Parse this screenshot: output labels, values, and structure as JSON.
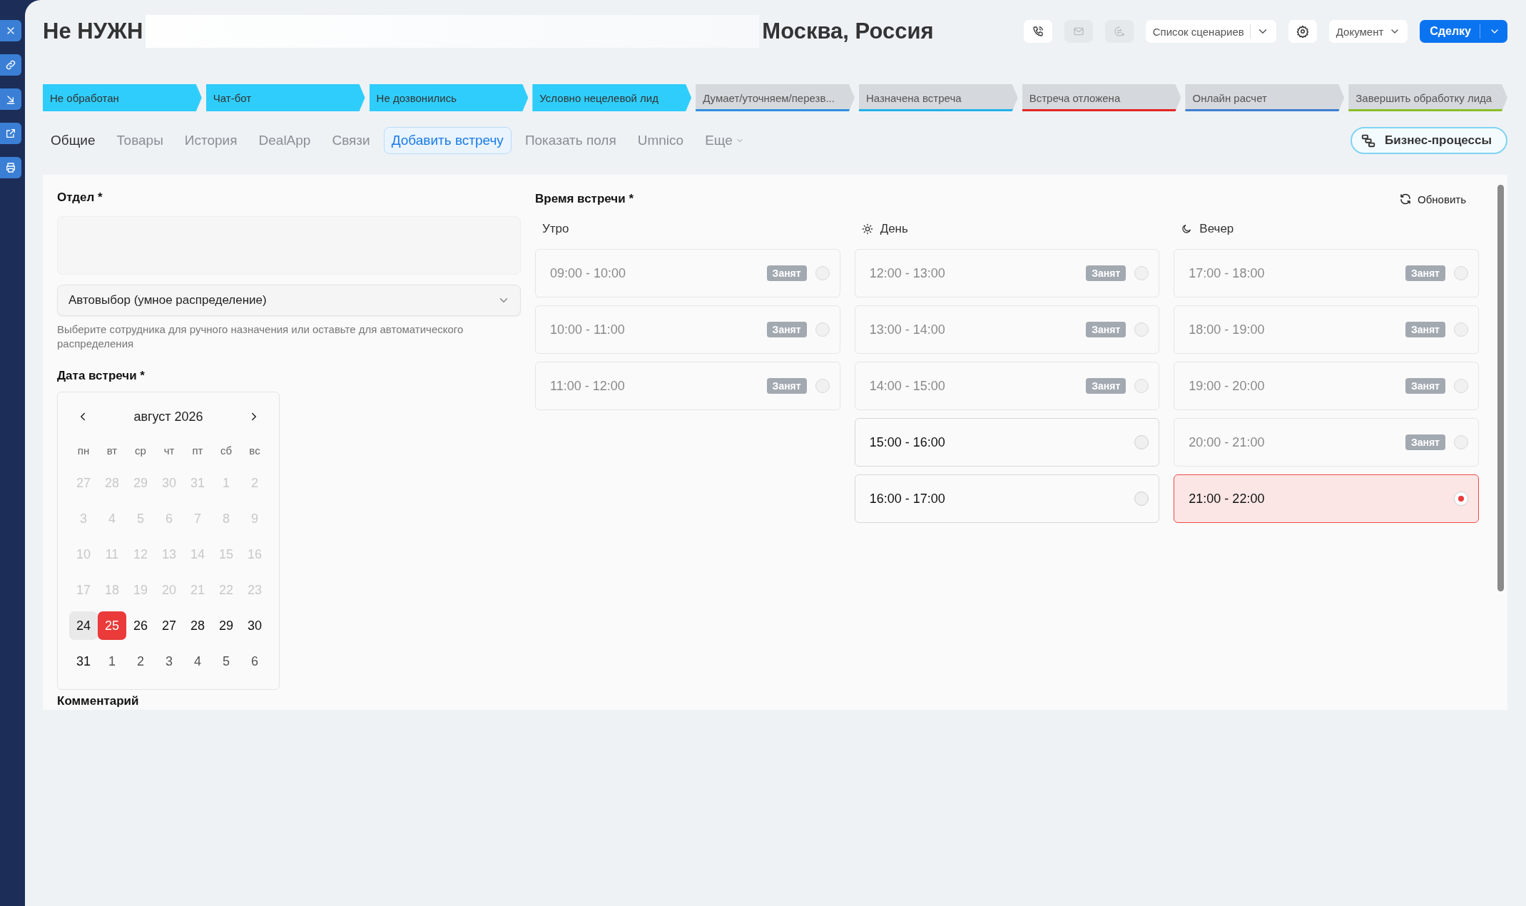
{
  "sidebar": {
    "buttons": [
      {
        "kind": "close"
      },
      {
        "kind": "link"
      },
      {
        "kind": "import"
      },
      {
        "kind": "external"
      },
      {
        "kind": "print"
      }
    ]
  },
  "header": {
    "title_start": "Не НУЖН",
    "title_end": "Москва, Россия",
    "icon_buttons": [
      {
        "kind": "phone",
        "disabled": false
      },
      {
        "kind": "mail",
        "disabled": true
      },
      {
        "kind": "chat",
        "disabled": true
      }
    ],
    "scenario_dropdown": "Список сценариев",
    "document_dropdown": "Документ",
    "primary_button": "Сделку"
  },
  "stages": [
    {
      "label": "Не обработан",
      "completed": true,
      "color": "#2fcdfb"
    },
    {
      "label": "Чат-бот",
      "completed": true,
      "color": "#2fcdfb"
    },
    {
      "label": "Не дозвонились",
      "completed": true,
      "color": "#2fcdfb"
    },
    {
      "label": "Условно нецелевой лид",
      "completed": true,
      "color": "#2fcdfb"
    },
    {
      "label": "Думает/уточняем/перезв...",
      "completed": false,
      "color": "#2f8fe0"
    },
    {
      "label": "Назначена встреча",
      "completed": false,
      "color": "#1fb2ea"
    },
    {
      "label": "Встреча отложена",
      "completed": false,
      "color": "#e52424"
    },
    {
      "label": "Онлайн расчет",
      "completed": false,
      "color": "#3c7fd0"
    },
    {
      "label": "Завершить обработку лида",
      "completed": false,
      "color": "#8bbd2a"
    }
  ],
  "tabs": [
    {
      "label": "Общие",
      "selected": false,
      "kind": "main"
    },
    {
      "label": "Товары",
      "selected": false,
      "kind": "plain"
    },
    {
      "label": "История",
      "selected": false,
      "kind": "plain"
    },
    {
      "label": "DealApp",
      "selected": false,
      "kind": "plain"
    },
    {
      "label": "Связи",
      "selected": false,
      "kind": "plain"
    },
    {
      "label": "Добавить встречу",
      "selected": true,
      "kind": "plain"
    },
    {
      "label": "Показать поля",
      "selected": false,
      "kind": "plain"
    },
    {
      "label": "Umnico",
      "selected": false,
      "kind": "plain"
    },
    {
      "label": "Еще",
      "selected": false,
      "kind": "more"
    }
  ],
  "business_processes_button": "Бизнес-процессы",
  "form": {
    "department_label": "Отдел *",
    "employee_select": "Автовыбор (умное распределение)",
    "employee_hint": "Выберите сотрудника для ручного назначения или оставьте для автоматического распределения",
    "date_label": "Дата встречи *",
    "comment_label": "Комментарий",
    "calendar": {
      "month": "август 2026",
      "weekdays": [
        "пн",
        "вт",
        "ср",
        "чт",
        "пт",
        "сб",
        "вс"
      ],
      "days": [
        {
          "d": "27",
          "kind": "past",
          "selected": false
        },
        {
          "d": "28",
          "kind": "past",
          "selected": false
        },
        {
          "d": "29",
          "kind": "past",
          "selected": false
        },
        {
          "d": "30",
          "kind": "past",
          "selected": false
        },
        {
          "d": "31",
          "kind": "past",
          "selected": false
        },
        {
          "d": "1",
          "kind": "past",
          "selected": false
        },
        {
          "d": "2",
          "kind": "past",
          "selected": false
        },
        {
          "d": "3",
          "kind": "past",
          "selected": false
        },
        {
          "d": "4",
          "kind": "past",
          "selected": false
        },
        {
          "d": "5",
          "kind": "past",
          "selected": false
        },
        {
          "d": "6",
          "kind": "past",
          "selected": false
        },
        {
          "d": "7",
          "kind": "past",
          "selected": false
        },
        {
          "d": "8",
          "kind": "past",
          "selected": false
        },
        {
          "d": "9",
          "kind": "past",
          "selected": false
        },
        {
          "d": "10",
          "kind": "past",
          "selected": false
        },
        {
          "d": "11",
          "kind": "past",
          "selected": false
        },
        {
          "d": "12",
          "kind": "past",
          "selected": false
        },
        {
          "d": "13",
          "kind": "past",
          "selected": false
        },
        {
          "d": "14",
          "kind": "past",
          "selected": false
        },
        {
          "d": "15",
          "kind": "past",
          "selected": false
        },
        {
          "d": "16",
          "kind": "past",
          "selected": false
        },
        {
          "d": "17",
          "kind": "past",
          "selected": false
        },
        {
          "d": "18",
          "kind": "past",
          "selected": false
        },
        {
          "d": "19",
          "kind": "past",
          "selected": false
        },
        {
          "d": "20",
          "kind": "past",
          "selected": false
        },
        {
          "d": "21",
          "kind": "past",
          "selected": false
        },
        {
          "d": "22",
          "kind": "past",
          "selected": false
        },
        {
          "d": "23",
          "kind": "past",
          "selected": false
        },
        {
          "d": "24",
          "kind": "today",
          "selected": false
        },
        {
          "d": "25",
          "kind": "current",
          "selected": true
        },
        {
          "d": "26",
          "kind": "current",
          "selected": false
        },
        {
          "d": "27",
          "kind": "current",
          "selected": false
        },
        {
          "d": "28",
          "kind": "current",
          "selected": false
        },
        {
          "d": "29",
          "kind": "current",
          "selected": false
        },
        {
          "d": "30",
          "kind": "current",
          "selected": false
        },
        {
          "d": "31",
          "kind": "current",
          "selected": false
        },
        {
          "d": "1",
          "kind": "next",
          "selected": false
        },
        {
          "d": "2",
          "kind": "next",
          "selected": false
        },
        {
          "d": "3",
          "kind": "next",
          "selected": false
        },
        {
          "d": "4",
          "kind": "next",
          "selected": false
        },
        {
          "d": "5",
          "kind": "next",
          "selected": false
        },
        {
          "d": "6",
          "kind": "next",
          "selected": false
        }
      ]
    }
  },
  "time": {
    "label": "Время встречи *",
    "refresh_button": "Обновить",
    "periods": [
      {
        "name": "Утро",
        "slots": [
          {
            "time": "09:00 - 10:00",
            "busy": true,
            "badge": "Занят",
            "selected": false
          },
          {
            "time": "10:00 - 11:00",
            "busy": true,
            "badge": "Занят",
            "selected": false
          },
          {
            "time": "11:00 - 12:00",
            "busy": true,
            "badge": "Занят",
            "selected": false
          }
        ]
      },
      {
        "name": "День",
        "kind": "day",
        "slots": [
          {
            "time": "12:00 - 13:00",
            "busy": true,
            "badge": "Занят",
            "selected": false
          },
          {
            "time": "13:00 - 14:00",
            "busy": true,
            "badge": "Занят",
            "selected": false
          },
          {
            "time": "14:00 - 15:00",
            "busy": true,
            "badge": "Занят",
            "selected": false
          },
          {
            "time": "15:00 - 16:00",
            "busy": false,
            "selected": false
          },
          {
            "time": "16:00 - 17:00",
            "busy": false,
            "selected": false
          }
        ]
      },
      {
        "name": "Вечер",
        "kind": "evening",
        "slots": [
          {
            "time": "17:00 - 18:00",
            "busy": true,
            "badge": "Занят",
            "selected": false
          },
          {
            "time": "18:00 - 19:00",
            "busy": true,
            "badge": "Занят",
            "selected": false
          },
          {
            "time": "19:00 - 20:00",
            "busy": true,
            "badge": "Занят",
            "selected": false
          },
          {
            "time": "20:00 - 21:00",
            "busy": true,
            "badge": "Занят",
            "selected": false
          },
          {
            "time": "21:00 - 22:00",
            "busy": false,
            "selected": true
          }
        ]
      }
    ]
  }
}
